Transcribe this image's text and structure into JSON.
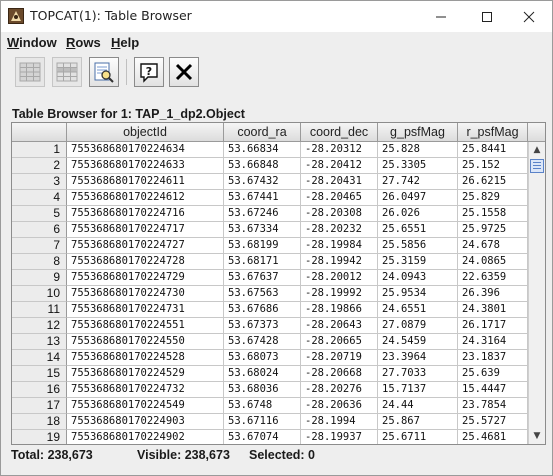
{
  "window": {
    "title": "TOPCAT(1): Table Browser"
  },
  "menu": [
    {
      "label": "Window",
      "mnemonic": "W",
      "rest": "indow"
    },
    {
      "label": "Rows",
      "mnemonic": "R",
      "rest": "ows"
    },
    {
      "label": "Help",
      "mnemonic": "H",
      "rest": "elp"
    }
  ],
  "toolbar": [
    {
      "name": "grid-full-icon",
      "enabled": false
    },
    {
      "name": "grid-partial-icon",
      "enabled": false
    },
    {
      "name": "table-search-icon",
      "enabled": true
    },
    {
      "name": "help-icon",
      "enabled": true
    },
    {
      "name": "close-icon",
      "enabled": true
    }
  ],
  "heading": "Table Browser for 1: TAP_1_dp2.Object",
  "table": {
    "columns": [
      "",
      "objectId",
      "coord_ra",
      "coord_dec",
      "g_psfMag",
      "r_psfMag"
    ],
    "rows": [
      [
        "1",
        "755368680170224634",
        "53.66834",
        "-28.20312",
        "25.828",
        "25.8441"
      ],
      [
        "2",
        "755368680170224633",
        "53.66848",
        "-28.20412",
        "25.3305",
        "25.152"
      ],
      [
        "3",
        "755368680170224611",
        "53.67432",
        "-28.20431",
        "27.742",
        "26.6215"
      ],
      [
        "4",
        "755368680170224612",
        "53.67441",
        "-28.20465",
        "26.0497",
        "25.829"
      ],
      [
        "5",
        "755368680170224716",
        "53.67246",
        "-28.20308",
        "26.026",
        "25.1558"
      ],
      [
        "6",
        "755368680170224717",
        "53.67334",
        "-28.20232",
        "25.6551",
        "25.9725"
      ],
      [
        "7",
        "755368680170224727",
        "53.68199",
        "-28.19984",
        "25.5856",
        "24.678"
      ],
      [
        "8",
        "755368680170224728",
        "53.68171",
        "-28.19942",
        "25.3159",
        "24.0865"
      ],
      [
        "9",
        "755368680170224729",
        "53.67637",
        "-28.20012",
        "24.0943",
        "22.6359"
      ],
      [
        "10",
        "755368680170224730",
        "53.67563",
        "-28.19992",
        "25.9534",
        "26.396"
      ],
      [
        "11",
        "755368680170224731",
        "53.67686",
        "-28.19866",
        "24.6551",
        "24.3801"
      ],
      [
        "12",
        "755368680170224551",
        "53.67373",
        "-28.20643",
        "27.0879",
        "26.1717"
      ],
      [
        "13",
        "755368680170224550",
        "53.67428",
        "-28.20665",
        "24.5459",
        "24.3164"
      ],
      [
        "14",
        "755368680170224528",
        "53.68073",
        "-28.20719",
        "23.3964",
        "23.1837"
      ],
      [
        "15",
        "755368680170224529",
        "53.68024",
        "-28.20668",
        "27.7033",
        "25.639"
      ],
      [
        "16",
        "755368680170224732",
        "53.68036",
        "-28.20276",
        "15.7137",
        "15.4447"
      ],
      [
        "17",
        "755368680170224549",
        "53.6748",
        "-28.20636",
        "24.44",
        "23.7854"
      ],
      [
        "18",
        "755368680170224903",
        "53.67116",
        "-28.1994",
        "25.867",
        "25.5727"
      ],
      [
        "19",
        "755368680170224902",
        "53.67074",
        "-28.19937",
        "25.6711",
        "25.4681"
      ]
    ]
  },
  "status": {
    "total": "Total: 238,673",
    "visible": "Visible: 238,673",
    "selected": "Selected: 0"
  }
}
